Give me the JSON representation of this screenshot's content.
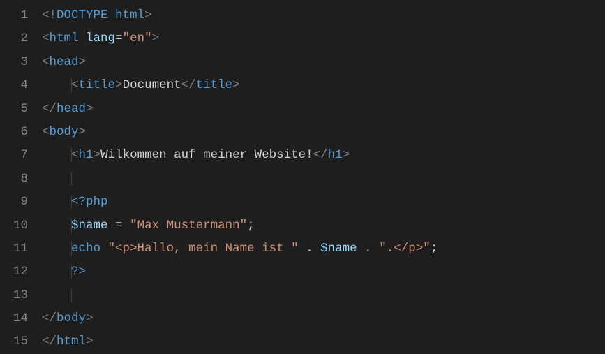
{
  "gutter": [
    "1",
    "2",
    "3",
    "4",
    "5",
    "6",
    "7",
    "8",
    "9",
    "10",
    "11",
    "12",
    "13",
    "14",
    "15"
  ],
  "code": {
    "l1": {
      "lt": "<!",
      "doctype": "DOCTYPE",
      "sp": " ",
      "html": "html",
      "gt": ">"
    },
    "l2": {
      "lt": "<",
      "tag": "html",
      "sp": " ",
      "attr": "lang",
      "eq": "=",
      "val": "\"en\"",
      "gt": ">"
    },
    "l3": {
      "lt": "<",
      "tag": "head",
      "gt": ">"
    },
    "l4": {
      "lt1": "<",
      "tag1": "title",
      "gt1": ">",
      "text": "Document",
      "lt2": "</",
      "tag2": "title",
      "gt2": ">"
    },
    "l5": {
      "lt": "</",
      "tag": "head",
      "gt": ">"
    },
    "l6": {
      "lt": "<",
      "tag": "body",
      "gt": ">"
    },
    "l7": {
      "lt1": "<",
      "tag1": "h1",
      "gt1": ">",
      "text": "Wilkommen auf meiner Website!",
      "lt2": "</",
      "tag2": "h1",
      "gt2": ">"
    },
    "l9": {
      "open": "<?php"
    },
    "l10": {
      "var": "$name",
      "sp1": " ",
      "eq": "=",
      "sp2": " ",
      "str": "\"Max Mustermann\"",
      "semi": ";"
    },
    "l11": {
      "kw": "echo",
      "sp1": " ",
      "s1": "\"<p>Hallo, mein Name ist \"",
      "sp2": " ",
      "d1": ".",
      "sp3": " ",
      "var": "$name",
      "sp4": " ",
      "d2": ".",
      "sp5": " ",
      "s2": "\".</p>\"",
      "semi": ";"
    },
    "l12": {
      "close": "?>"
    },
    "l14": {
      "lt": "</",
      "tag": "body",
      "gt": ">"
    },
    "l15": {
      "lt": "</",
      "tag": "html",
      "gt": ">"
    }
  }
}
